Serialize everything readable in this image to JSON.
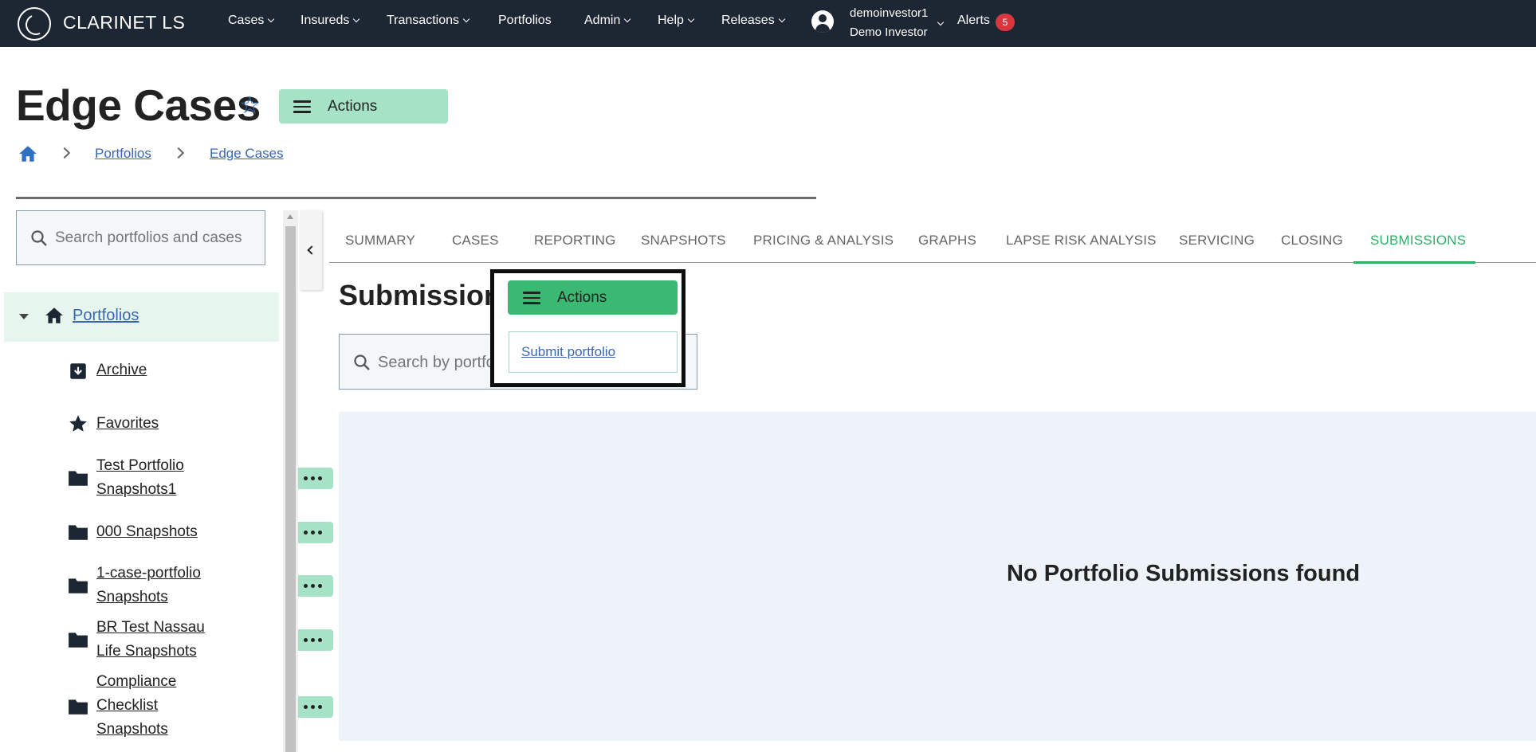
{
  "navbar": {
    "brand": "CLARINET LS",
    "menu": [
      {
        "label": "Cases"
      },
      {
        "label": "Insureds"
      },
      {
        "label": "Transactions"
      },
      {
        "label": "Portfolios"
      },
      {
        "label": "Admin"
      },
      {
        "label": "Help"
      },
      {
        "label": "Releases"
      }
    ],
    "user": {
      "username": "demoinvestor1",
      "display_name": "Demo Investor"
    },
    "alerts": {
      "label": "Alerts",
      "count": "5"
    }
  },
  "header": {
    "title": "Edge Cases",
    "actions_label": "Actions",
    "breadcrumb": [
      {
        "label": "Portfolios"
      },
      {
        "label": "Edge Cases"
      }
    ]
  },
  "sidebar": {
    "search_placeholder": "Search portfolios and cases",
    "root": {
      "label": "Portfolios"
    },
    "items": [
      {
        "label": "Archive",
        "icon": "archive-icon"
      },
      {
        "label": "Favorites",
        "icon": "star-icon"
      },
      {
        "label": "Test Portfolio Snapshots1",
        "icon": "folder-icon"
      },
      {
        "label": "000 Snapshots",
        "icon": "folder-icon"
      },
      {
        "label": "1-case-portfolio Snapshots",
        "icon": "folder-icon"
      },
      {
        "label": "BR Test Nassau Life Snapshots",
        "icon": "folder-icon"
      },
      {
        "label": "Compliance Checklist Snapshots",
        "icon": "folder-icon"
      }
    ]
  },
  "tabs": [
    {
      "label": "SUMMARY"
    },
    {
      "label": "CASES"
    },
    {
      "label": "REPORTING"
    },
    {
      "label": "SNAPSHOTS"
    },
    {
      "label": "PRICING & ANALYSIS"
    },
    {
      "label": "GRAPHS"
    },
    {
      "label": "LAPSE RISK ANALYSIS"
    },
    {
      "label": "SERVICING"
    },
    {
      "label": "CLOSING"
    },
    {
      "label": "SUBMISSIONS"
    }
  ],
  "active_tab": "SUBMISSIONS",
  "main": {
    "title": "Submissions",
    "search_placeholder": "Search by portfolio",
    "actions_label": "Actions",
    "actions_menu": [
      {
        "label": "Submit portfolio"
      }
    ],
    "empty_message": "No Portfolio Submissions found"
  },
  "colors": {
    "navbar_bg": "#1c2733",
    "accent_green": "#3bb871",
    "light_green": "#a6e3c6",
    "link_blue": "#3a67b0",
    "alert_red": "#d9363e",
    "empty_panel_bg": "#edf3f9"
  }
}
